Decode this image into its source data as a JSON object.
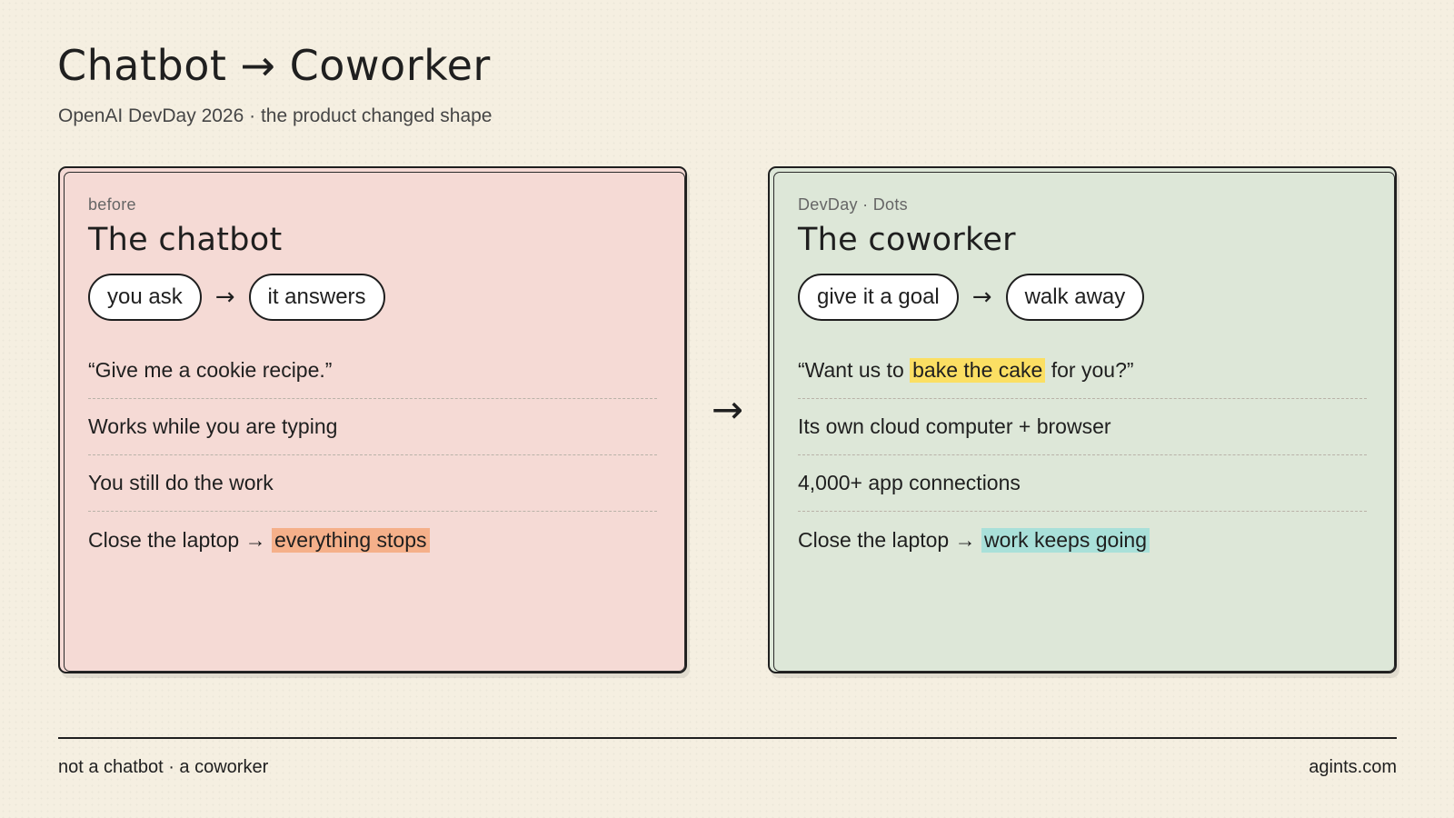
{
  "header": {
    "title": "Chatbot → Coworker",
    "subtitle": "OpenAI DevDay 2026 · the product changed shape"
  },
  "left_panel": {
    "eyebrow": "before",
    "title": "The chatbot",
    "flow": {
      "from": "you ask",
      "arrow": "→",
      "to": "it answers"
    },
    "rows": {
      "quote": "“Give me a cookie recipe.”",
      "row2": "Works while you are typing",
      "row3": "You still do the work",
      "row4_prefix": "Close the laptop → ",
      "row4_highlight": "everything stops"
    },
    "background_color": "#f5dad5",
    "highlight_color": "#f5b08a"
  },
  "center_arrow": "→",
  "right_panel": {
    "eyebrow": "DevDay · Dots",
    "title": "The coworker",
    "flow": {
      "from": "give it a goal",
      "arrow": "→",
      "to": "walk away"
    },
    "rows": {
      "quote_prefix": "“Want us to ",
      "quote_highlight": "bake the cake",
      "quote_suffix": " for you?”",
      "row2": "Its own cloud computer + browser",
      "row3": "4,000+ app connections",
      "row4_prefix": "Close the laptop → ",
      "row4_highlight": "work keeps going"
    },
    "background_color": "#dde7d8",
    "quote_highlight_color": "#fbdf63",
    "highlight_color": "#a9e0d9"
  },
  "footer": {
    "left": "not a chatbot · a coworker",
    "right": "agints.com"
  },
  "page_background": "#f5efe1"
}
